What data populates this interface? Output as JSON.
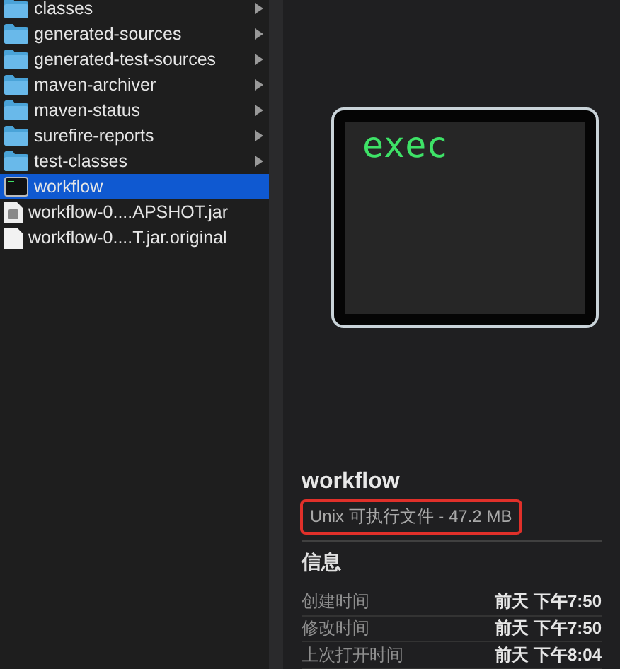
{
  "files": [
    {
      "name": "classes",
      "kind": "folder",
      "has_children": true,
      "selected": false
    },
    {
      "name": "generated-sources",
      "kind": "folder",
      "has_children": true,
      "selected": false
    },
    {
      "name": "generated-test-sources",
      "kind": "folder",
      "has_children": true,
      "selected": false
    },
    {
      "name": "maven-archiver",
      "kind": "folder",
      "has_children": true,
      "selected": false
    },
    {
      "name": "maven-status",
      "kind": "folder",
      "has_children": true,
      "selected": false
    },
    {
      "name": "surefire-reports",
      "kind": "folder",
      "has_children": true,
      "selected": false
    },
    {
      "name": "test-classes",
      "kind": "folder",
      "has_children": true,
      "selected": false
    },
    {
      "name": "workflow",
      "kind": "exec",
      "has_children": false,
      "selected": true
    },
    {
      "name": "workflow-0....APSHOT.jar",
      "kind": "jar",
      "has_children": false,
      "selected": false
    },
    {
      "name": "workflow-0....T.jar.original",
      "kind": "file",
      "has_children": false,
      "selected": false
    }
  ],
  "preview": {
    "icon_text": "exec",
    "name": "workflow",
    "kind_text": "Unix 可执行文件 - 47.2 MB",
    "kind_highlighted": true,
    "section_title": "信息",
    "info": [
      {
        "label": "创建时间",
        "value": "前天 下午7:50"
      },
      {
        "label": "修改时间",
        "value": "前天 下午7:50"
      },
      {
        "label": "上次打开时间",
        "value": "前天 下午8:04"
      }
    ]
  }
}
